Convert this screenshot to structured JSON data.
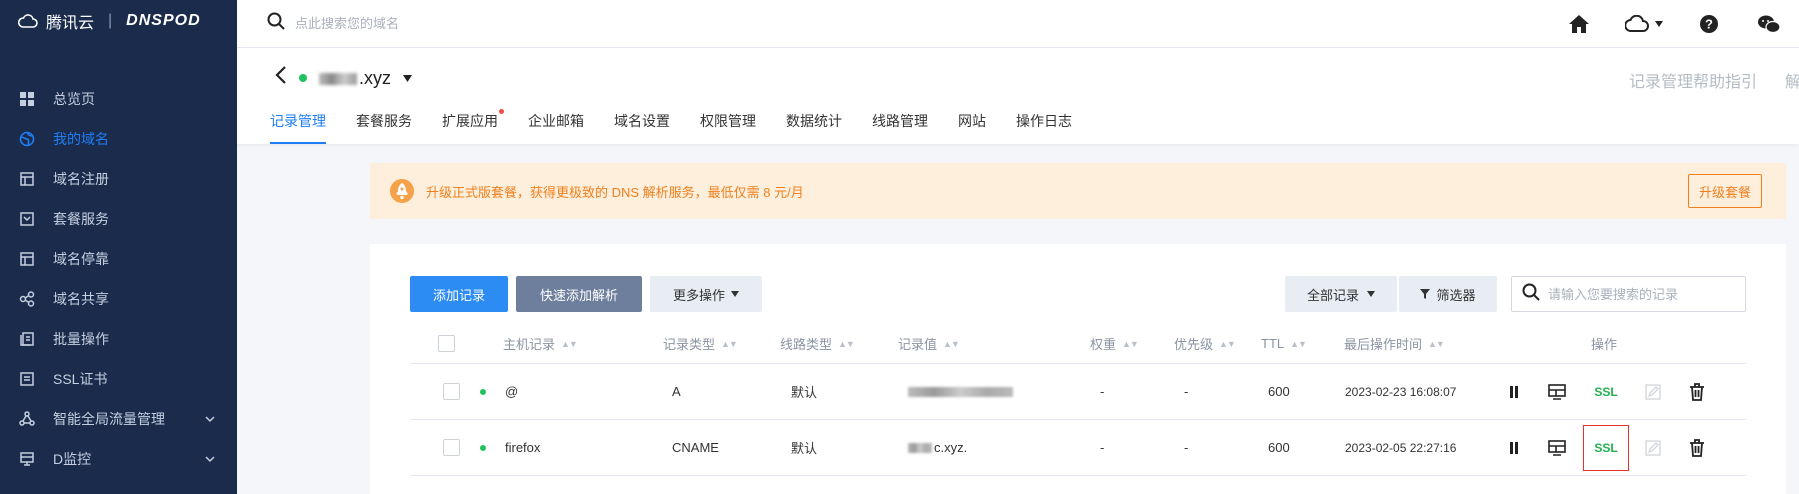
{
  "brand": {
    "cloud_name": "腾讯云",
    "product": "DNSPOD"
  },
  "sidebar": {
    "items": [
      {
        "label": "总览页",
        "icon": "dashboard-icon"
      },
      {
        "label": "我的域名",
        "icon": "globe-icon",
        "active": true
      },
      {
        "label": "域名注册",
        "icon": "register-icon"
      },
      {
        "label": "套餐服务",
        "icon": "package-icon"
      },
      {
        "label": "域名停靠",
        "icon": "parking-icon"
      },
      {
        "label": "域名共享",
        "icon": "share-icon"
      },
      {
        "label": "批量操作",
        "icon": "batch-icon"
      },
      {
        "label": "SSL证书",
        "icon": "certificate-icon"
      },
      {
        "label": "智能全局流量管理",
        "icon": "traffic-icon",
        "expandable": true
      },
      {
        "label": "D监控",
        "icon": "monitor-icon",
        "expandable": true
      }
    ]
  },
  "topbar": {
    "search_placeholder": "点此搜索您的域名"
  },
  "header": {
    "domain_suffix": ".xyz",
    "help_link": "记录管理帮助指引",
    "help_link_2": "解",
    "tabs": [
      {
        "label": "记录管理",
        "active": true
      },
      {
        "label": "套餐服务"
      },
      {
        "label": "扩展应用",
        "badge_dot": true
      },
      {
        "label": "企业邮箱"
      },
      {
        "label": "域名设置"
      },
      {
        "label": "权限管理"
      },
      {
        "label": "数据统计"
      },
      {
        "label": "线路管理"
      },
      {
        "label": "网站"
      },
      {
        "label": "操作日志"
      }
    ]
  },
  "banner": {
    "text": "升级正式版套餐，获得更极致的 DNS 解析服务，最低仅需 8 元/月",
    "button": "升级套餐"
  },
  "toolbar": {
    "add_record": "添加记录",
    "quick_add": "快速添加解析",
    "more_ops": "更多操作",
    "all_records": "全部记录",
    "filter": "筛选器",
    "search_placeholder": "请输入您要搜索的记录"
  },
  "table": {
    "headers": {
      "host": "主机记录",
      "type": "记录类型",
      "line": "线路类型",
      "value": "记录值",
      "weight": "权重",
      "priority": "优先级",
      "ttl": "TTL",
      "updated": "最后操作时间",
      "actions": "操作"
    },
    "rows": [
      {
        "host": "@",
        "type": "A",
        "line": "默认",
        "value": "",
        "weight": "-",
        "priority": "-",
        "ttl": "600",
        "updated": "2023-02-23 16:08:07",
        "ssl": "SSL"
      },
      {
        "host": "firefox",
        "type": "CNAME",
        "line": "默认",
        "value": "c.xyz.",
        "weight": "-",
        "priority": "-",
        "ttl": "600",
        "updated": "2023-02-05 22:27:16",
        "ssl": "SSL"
      }
    ]
  },
  "colors": {
    "sidebar_bg": "#1a2b4c",
    "accent": "#1f7ef5",
    "banner_bg": "#fdefdc",
    "banner_text": "#f07f1d",
    "ssl_green": "#20b050",
    "highlight_red": "#e0322b"
  }
}
